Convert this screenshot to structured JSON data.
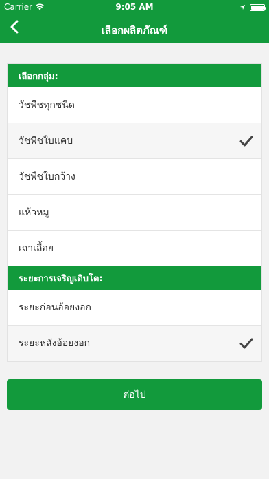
{
  "status_bar": {
    "carrier": "Carrier",
    "time": "9:05 AM",
    "battery_level": 1.0
  },
  "header": {
    "title": "เลือกผลิตภัณฑ์",
    "back_icon": "chevron-left-icon"
  },
  "sections": [
    {
      "title": "เลือกกลุ่ม:",
      "items": [
        {
          "label": "วัชพืชทุกชนิด",
          "selected": false
        },
        {
          "label": "วัชพืชใบแคบ",
          "selected": true
        },
        {
          "label": "วัชพืชใบกว้าง",
          "selected": false
        },
        {
          "label": "แห้วหมู",
          "selected": false
        },
        {
          "label": "เถาเลื้อย",
          "selected": false
        }
      ]
    },
    {
      "title": "ระยะการเจริญเติบโต:",
      "items": [
        {
          "label": "ระยะก่อนอ้อยงอก",
          "selected": false
        },
        {
          "label": "ระยะหลังอ้อยงอก",
          "selected": true
        }
      ]
    }
  ],
  "next_button": {
    "label": "ต่อไป"
  },
  "colors": {
    "brand": "#129a3c",
    "background": "#f2f2f2",
    "check": "#444444"
  }
}
